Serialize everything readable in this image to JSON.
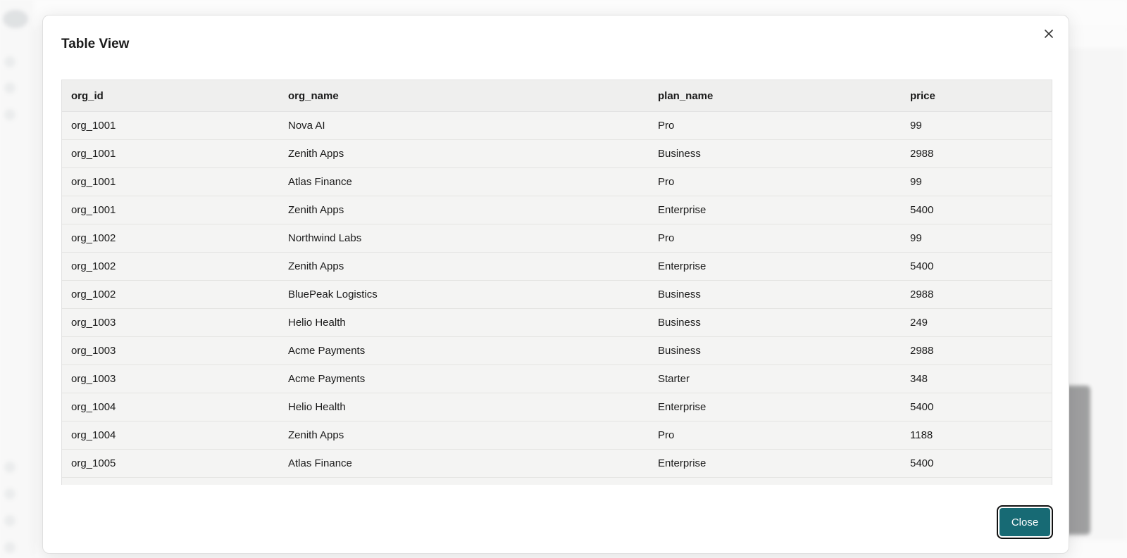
{
  "modal": {
    "title": "Table View",
    "close_icon": "close-icon",
    "close_button_label": "Close",
    "accent_color": "#176a74"
  },
  "table": {
    "columns": [
      "org_id",
      "org_name",
      "plan_name",
      "price"
    ],
    "rows": [
      [
        "org_1001",
        "Nova AI",
        "Pro",
        "99"
      ],
      [
        "org_1001",
        "Zenith Apps",
        "Business",
        "2988"
      ],
      [
        "org_1001",
        "Atlas Finance",
        "Pro",
        "99"
      ],
      [
        "org_1001",
        "Zenith Apps",
        "Enterprise",
        "5400"
      ],
      [
        "org_1002",
        "Northwind Labs",
        "Pro",
        "99"
      ],
      [
        "org_1002",
        "Zenith Apps",
        "Enterprise",
        "5400"
      ],
      [
        "org_1002",
        "BluePeak Logistics",
        "Business",
        "2988"
      ],
      [
        "org_1003",
        "Helio Health",
        "Business",
        "249"
      ],
      [
        "org_1003",
        "Acme Payments",
        "Business",
        "2988"
      ],
      [
        "org_1003",
        "Acme Payments",
        "Starter",
        "348"
      ],
      [
        "org_1004",
        "Helio Health",
        "Enterprise",
        "5400"
      ],
      [
        "org_1004",
        "Zenith Apps",
        "Pro",
        "1188"
      ],
      [
        "org_1005",
        "Atlas Finance",
        "Enterprise",
        "5400"
      ]
    ]
  }
}
